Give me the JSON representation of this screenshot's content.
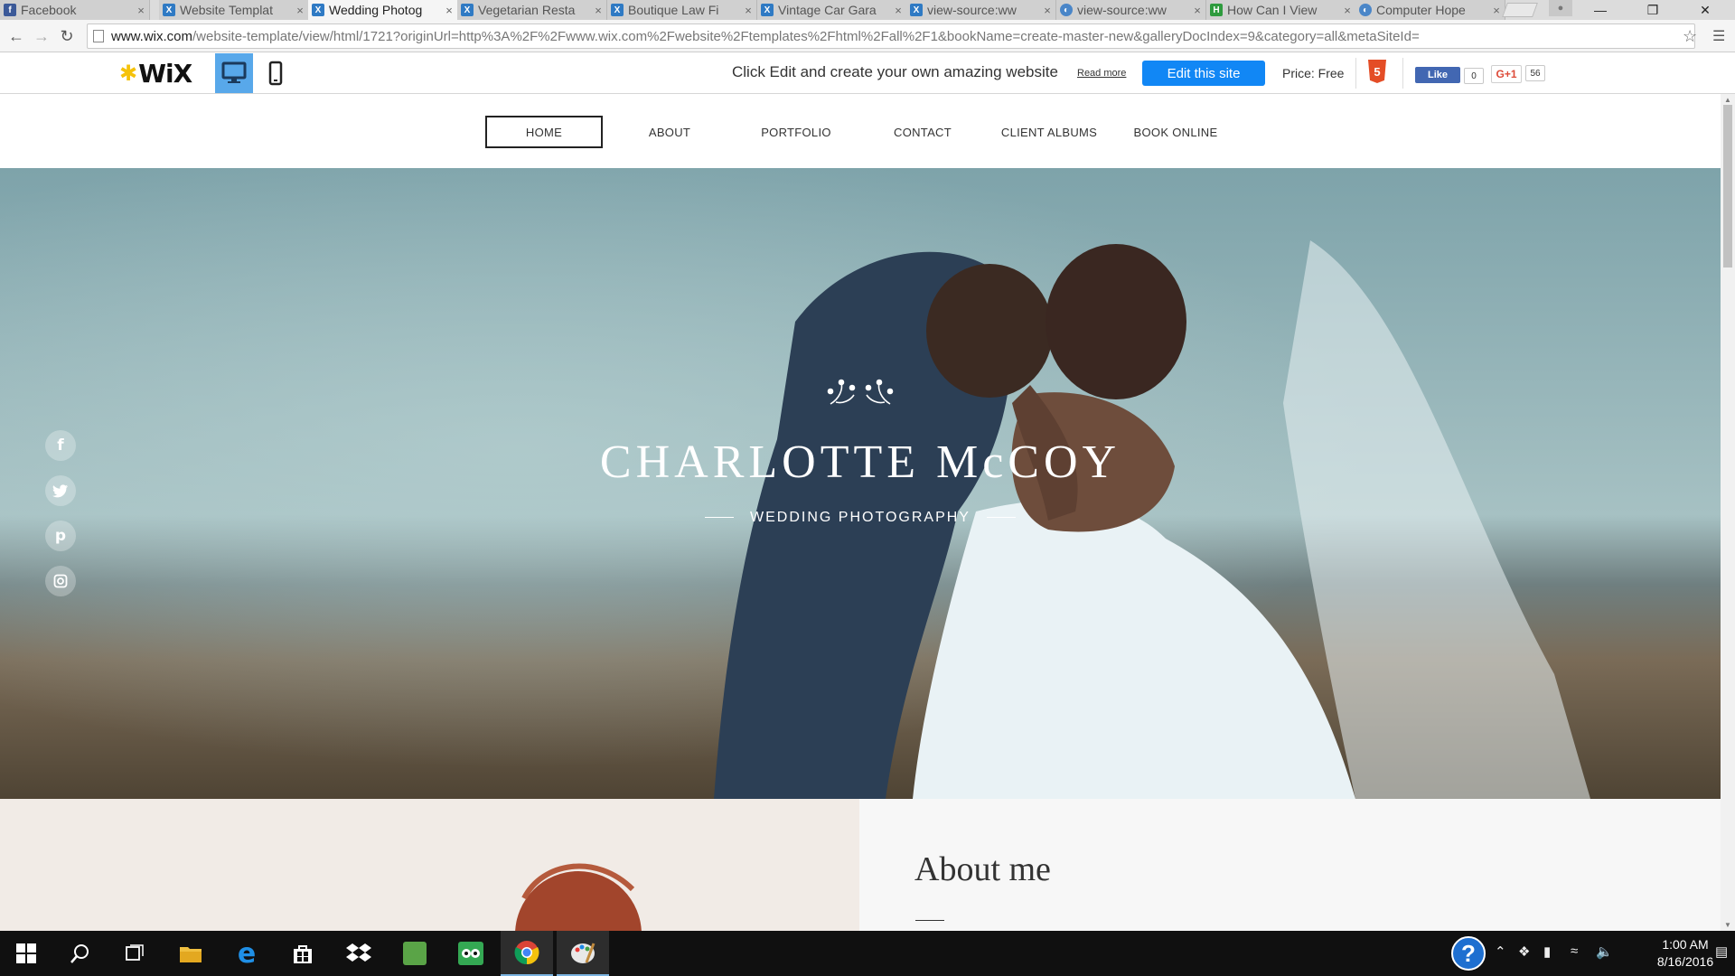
{
  "browser": {
    "tabs": [
      {
        "title": "Facebook",
        "icon": "facebook-icon",
        "color": "#3b5998"
      },
      {
        "title": "Website Templat",
        "icon": "wix-icon",
        "color": "#2f7ac4"
      },
      {
        "title": "Wedding Photog",
        "icon": "wix-icon",
        "color": "#2f7ac4"
      },
      {
        "title": "Vegetarian Resta",
        "icon": "wix-icon",
        "color": "#2f7ac4"
      },
      {
        "title": "Boutique Law Fi",
        "icon": "wix-icon",
        "color": "#2f7ac4"
      },
      {
        "title": "Vintage Car Gara",
        "icon": "wix-icon",
        "color": "#2f7ac4"
      },
      {
        "title": "view-source:ww",
        "icon": "wix-icon",
        "color": "#2f7ac4"
      },
      {
        "title": "view-source:ww",
        "icon": "chrome-page-icon",
        "color": "#4a86c8"
      },
      {
        "title": "How Can I View",
        "icon": "green-icon",
        "color": "#2e9b3e"
      },
      {
        "title": "Computer Hope",
        "icon": "chrome-page-icon",
        "color": "#4a86c8"
      }
    ],
    "tab_close": "×",
    "url_host": "www.wix.com",
    "url_path": "/website-template/view/html/1721?originUrl=http%3A%2F%2Fwww.wix.com%2Fwebsite%2Ftemplates%2Fhtml%2Fall%2F1&bookName=create-master-new&galleryDocIndex=9&category=all&metaSiteId="
  },
  "wix_bar": {
    "logo": "WiX",
    "promo": "Click Edit and create your own amazing website",
    "read_more": "Read more",
    "edit_button": "Edit this site",
    "price": "Price: Free",
    "html5_badge": "5",
    "fb_like": "Like",
    "fb_count": "0",
    "gplus_label": "G+1",
    "gplus_count": "56"
  },
  "site_nav": {
    "items": [
      "HOME",
      "ABOUT",
      "PORTFOLIO",
      "CONTACT",
      "CLIENT ALBUMS",
      "BOOK ONLINE"
    ],
    "active_index": 0
  },
  "hero": {
    "title": "CHARLOTTE McCOY",
    "subtitle": "WEDDING PHOTOGRAPHY",
    "social_icons": [
      "facebook-icon",
      "twitter-icon",
      "pinterest-icon",
      "instagram-icon"
    ]
  },
  "about": {
    "title": "About me"
  },
  "taskbar": {
    "time": "1:00 AM",
    "date": "8/16/2016",
    "apps": [
      "start-icon",
      "search-icon",
      "task-view-icon",
      "file-explorer-icon",
      "edge-icon",
      "store-icon",
      "dropbox-icon",
      "evernote-icon",
      "tripadvisor-icon",
      "chrome-icon",
      "paint-icon"
    ]
  }
}
